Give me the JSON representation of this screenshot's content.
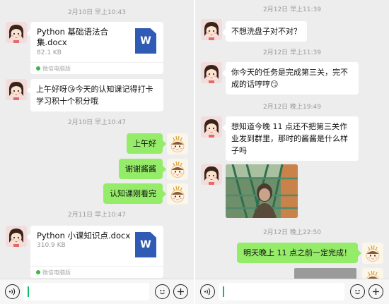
{
  "left": {
    "timestamps": [
      "2月10日 早上10:43",
      "2月10日 早上10:47",
      "2月11日 早上10:47"
    ],
    "file1": {
      "name": "Python 基础语法合集.docx",
      "size": "82.1 KB",
      "source": "微信电脑版",
      "icon_letter": "W"
    },
    "message1": "上午好呀😘今天的认知课记得打卡学习积十个积分哦",
    "out_messages": [
      "上午好",
      "谢谢酱酱",
      "认知课刚看完"
    ],
    "file2": {
      "name": "Python 小课知识点.docx",
      "size": "310.9 KB",
      "source": "微信电脑版",
      "icon_letter": "W"
    }
  },
  "right": {
    "timestamps": [
      "2月12日 早上11:39",
      "2月12日 早上11:39",
      "2月12日 晚上19:49",
      "2月12日 晚上22:50"
    ],
    "messages": [
      "不想洗盘子对不对？",
      "你今天的任务是完成第三关，完不成的话哼哼😏",
      "想知道今晚 11 点还不把第三关作业发到群里，那时的酱酱是什么样子吗"
    ],
    "out_message": "明天晚上 11 点之前一定完成！"
  },
  "colors": {
    "chat_bg": "#ededed",
    "out_bubble": "#95ec69",
    "in_bubble": "#ffffff",
    "word_blue": "#2f5bb5",
    "caret": "#07c160"
  },
  "icons": [
    "voice-icon",
    "emoji-icon",
    "plus-icon",
    "word-file-icon"
  ]
}
